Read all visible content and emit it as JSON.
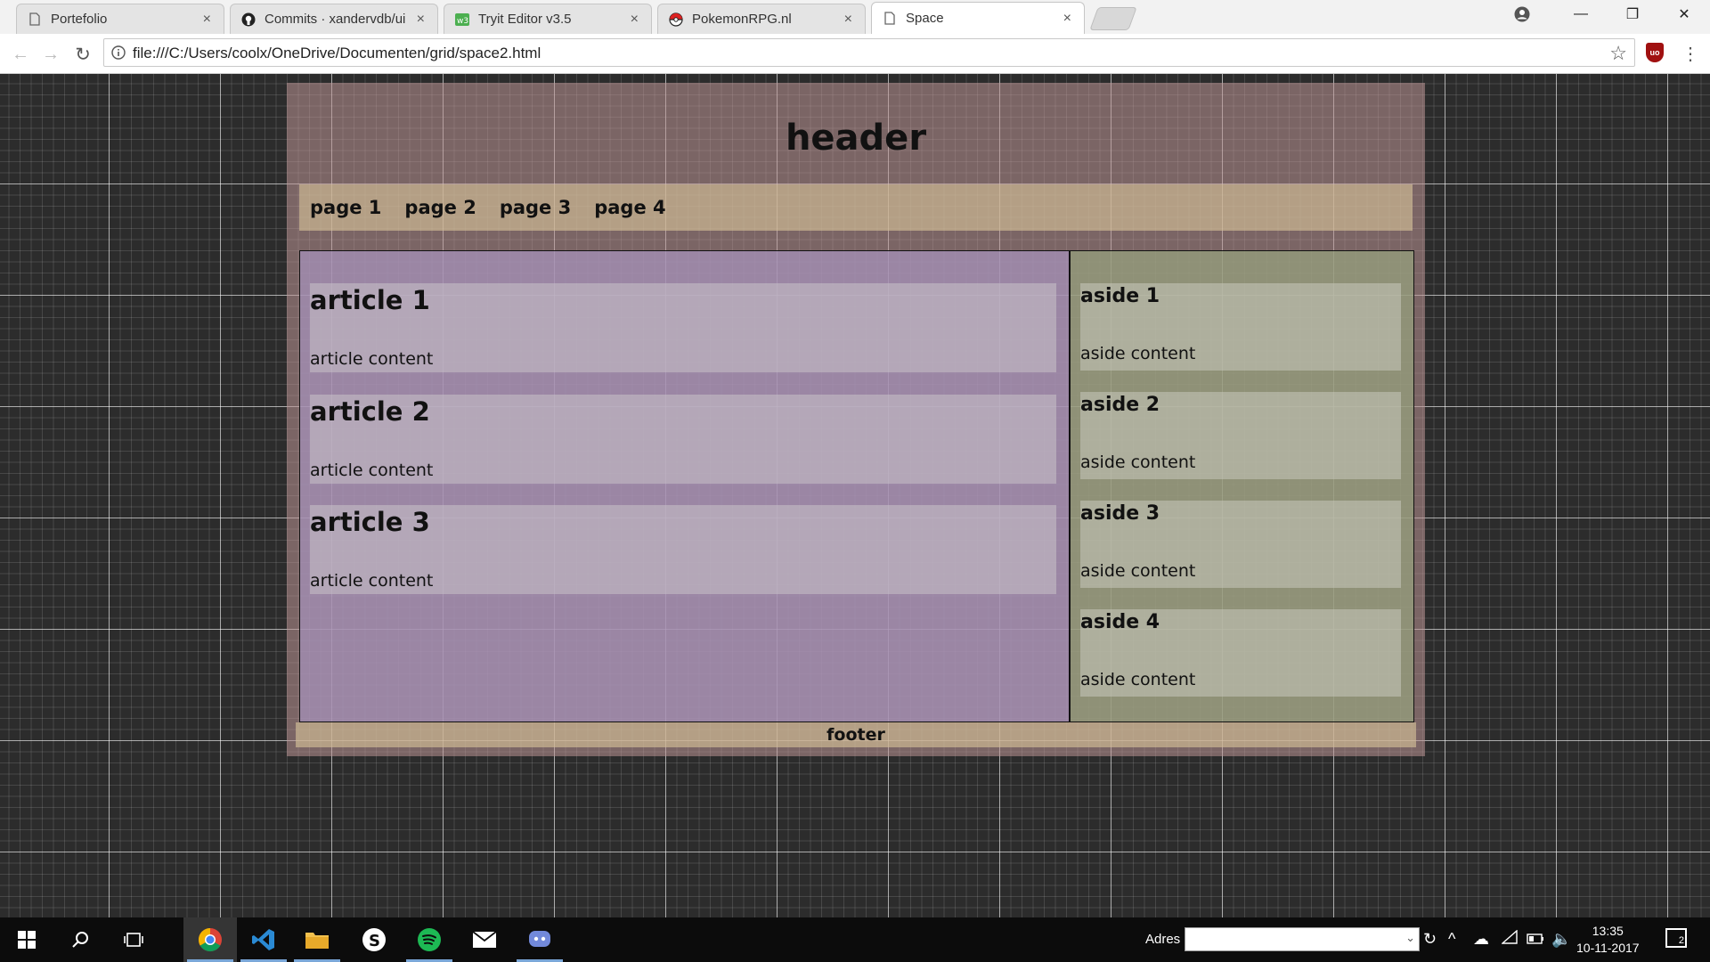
{
  "browser": {
    "tabs": [
      {
        "title": "Portefolio",
        "icon": "page-icon",
        "active": false
      },
      {
        "title": "Commits · xandervdb/ui",
        "icon": "github-icon",
        "active": false
      },
      {
        "title": "Tryit Editor v3.5",
        "icon": "w3schools-icon",
        "active": false
      },
      {
        "title": "PokemonRPG.nl",
        "icon": "pokeball-icon",
        "active": false
      },
      {
        "title": "Space",
        "icon": "page-icon",
        "active": true
      }
    ],
    "tab_close_glyph": "×",
    "url": "file:///C:/Users/coolx/OneDrive/Documenten/grid/space2.html",
    "extension_badge": "uo",
    "window_controls": {
      "minimize": "—",
      "restore": "❐",
      "close": "✕"
    }
  },
  "page": {
    "header": "header",
    "nav": [
      "page 1",
      "page 2",
      "page 3",
      "page 4"
    ],
    "articles": [
      {
        "title": "article 1",
        "content": "article content"
      },
      {
        "title": "article 2",
        "content": "article content"
      },
      {
        "title": "article 3",
        "content": "article content"
      }
    ],
    "asides": [
      {
        "title": "aside 1",
        "content": "aside content"
      },
      {
        "title": "aside 2",
        "content": "aside content"
      },
      {
        "title": "aside 3",
        "content": "aside content"
      },
      {
        "title": "aside 4",
        "content": "aside content"
      }
    ],
    "footer": "footer"
  },
  "taskbar": {
    "apps": [
      "start-icon",
      "search-icon",
      "task-view-icon",
      "chrome-icon",
      "vscode-icon",
      "file-explorer-icon",
      "skype-icon",
      "spotify-icon",
      "mail-icon",
      "discord-icon"
    ],
    "address_label": "Adres",
    "time": "13:35",
    "date": "10-11-2017",
    "notification_count": "2"
  },
  "colors": {
    "chrome_tab_bg": "#e4e4e4",
    "viewport_bg": "#2c2c2c",
    "header_bg": "#be9696",
    "nav_bg": "#d2be96",
    "main_bg": "#a591b9",
    "aside_bg": "#96a07d",
    "taskbar_bg": "#0c0c0c"
  }
}
